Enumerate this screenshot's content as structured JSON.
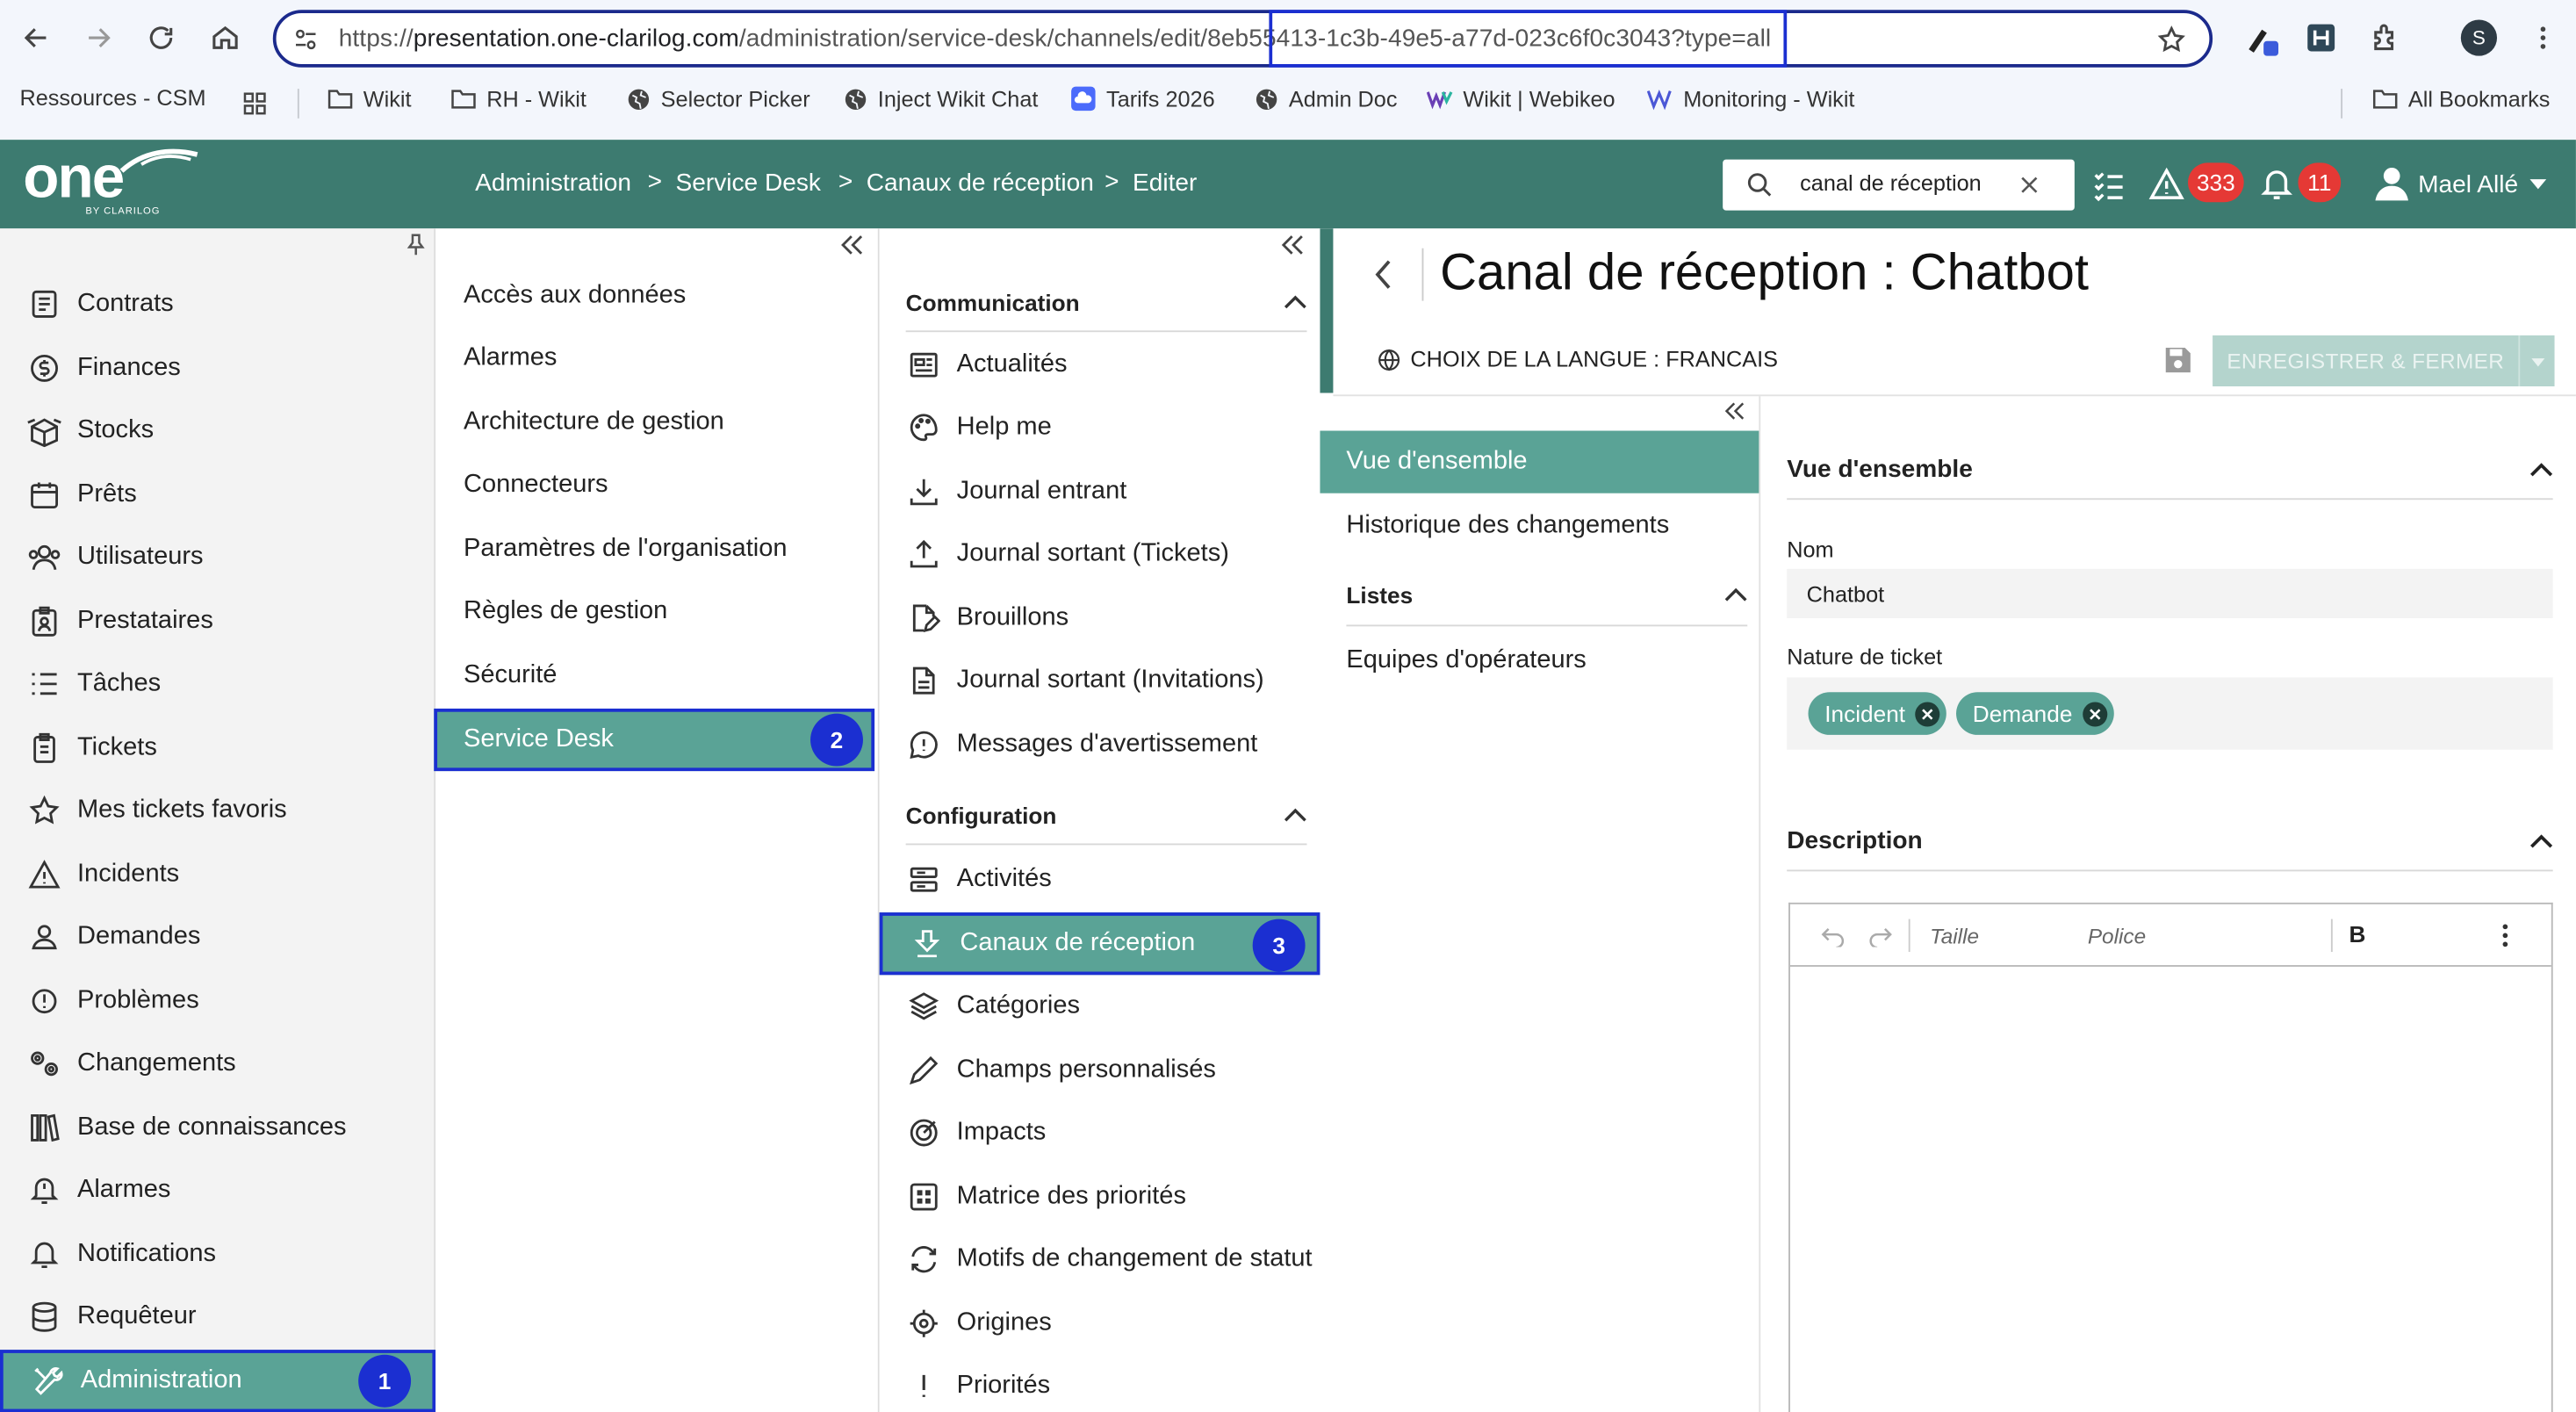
{
  "browser": {
    "url_prefix": "https://",
    "url_host": "presentation.one-clarilog.com",
    "url_path": "/administration/service-desk/channels/edit/",
    "url_id": "8eb55413-1c3b-49e5-a77d-023c6f0c3043",
    "url_query": "?type=all",
    "profile_initial": "S",
    "bookmarks": [
      "Ressources - CSM",
      "Wikit",
      "RH - Wikit",
      "Selector Picker",
      "Inject Wikit Chat",
      "Tarifs 2026",
      "Admin Doc",
      "Wikit | Webikeo",
      "Monitoring - Wikit"
    ],
    "all_bookmarks": "All Bookmarks"
  },
  "header": {
    "logo_word": "one",
    "logo_sub": "BY CLARILOG",
    "breadcrumb": [
      "Administration",
      "Service Desk",
      "Canaux de réception",
      "Editer"
    ],
    "search_value": "canal de réception",
    "alerts_count": "333",
    "notifications_count": "11",
    "user_name": "Mael Allé"
  },
  "sidebar": {
    "items": [
      "Contrats",
      "Finances",
      "Stocks",
      "Prêts",
      "Utilisateurs",
      "Prestataires",
      "Tâches",
      "Tickets",
      "Mes tickets favoris",
      "Incidents",
      "Demandes",
      "Problèmes",
      "Changements",
      "Base de connaissances",
      "Alarmes",
      "Notifications",
      "Requêteur",
      "Administration"
    ],
    "active_step": "1"
  },
  "admin_menu": {
    "items": [
      "Accès aux données",
      "Alarmes",
      "Architecture de gestion",
      "Connecteurs",
      "Paramètres de l'organisation",
      "Règles de gestion",
      "Sécurité",
      "Service Desk"
    ],
    "active_step": "2"
  },
  "service_desk_menu": {
    "communication_title": "Communication",
    "communication_items": [
      "Actualités",
      "Help me",
      "Journal entrant",
      "Journal sortant (Tickets)",
      "Brouillons",
      "Journal sortant (Invitations)",
      "Messages d'avertissement"
    ],
    "configuration_title": "Configuration",
    "configuration_items": [
      "Activités",
      "Canaux de réception",
      "Catégories",
      "Champs personnalisés",
      "Impacts",
      "Matrice des priorités",
      "Motifs de changement de statut",
      "Origines",
      "Priorités"
    ],
    "active_step": "3"
  },
  "main": {
    "title": "Canal de réception : Chatbot",
    "language_label": "CHOIX DE LA LANGUE : FRANCAIS",
    "save_close_label": "ENREGISTRER & FERMER",
    "subnav": {
      "items": [
        "Vue d'ensemble",
        "Historique des changements"
      ],
      "lists_title": "Listes",
      "list_items": [
        "Equipes d'opérateurs"
      ]
    },
    "overview": {
      "section_title": "Vue d'ensemble",
      "name_label": "Nom",
      "name_value": "Chatbot",
      "nature_label": "Nature de ticket",
      "nature_values": [
        "Incident",
        "Demande"
      ]
    },
    "description": {
      "section_title": "Description",
      "toolbar_size": "Taille",
      "toolbar_font": "Police",
      "toolbar_bold": "B"
    }
  }
}
